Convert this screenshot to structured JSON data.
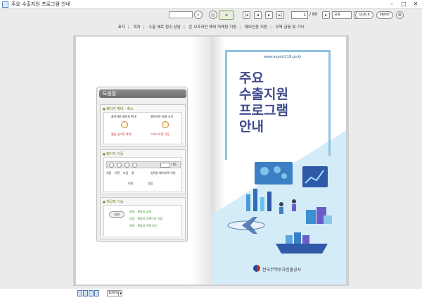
{
  "window": {
    "title": "주요 수출지원 프로그램 안내"
  },
  "toolbar": {
    "search_placeholder": "",
    "page_current": "1",
    "page_total": "/ 80",
    "zoom_option": "공동",
    "quick_label": "QUICK",
    "print_label": "PRINT"
  },
  "toc": {
    "items": [
      "표지",
      "목차",
      "수출 애로 접수·상담",
      "온·오프라인 해외 마케팅 지원",
      "해외인증 지원",
      "무역 금융 및 기타"
    ]
  },
  "help": {
    "title": "도움말",
    "sections": {
      "zoom": {
        "heading": "페이지 확대 · 축소",
        "left_label": "클릭하면 페이지 확대",
        "left_caption": "휠을 굴리면 확대",
        "right_label": "클릭하면 원래 크기",
        "right_caption": "드래그하면 이동"
      },
      "move": {
        "heading": "페이지 이동",
        "total": "/ 56",
        "labels": [
          "처음",
          "이전",
          "다음",
          "끝",
          "입력한 페이지로 이동"
        ],
        "prev": "이전",
        "next": "다음"
      },
      "bookmark": {
        "heading": "책갈피 기능",
        "pill": "검색",
        "lines": [
          "검색 - 책갈피 검색",
          "이동 - 책갈피 목록으로 이동",
          "목록 - 책갈피 목록 열기"
        ]
      }
    }
  },
  "cover": {
    "url": "www.export119.go.kr",
    "title_lines": [
      "주요",
      "수출지원",
      "프로그램",
      "안내"
    ],
    "org": "한국무역투자진흥공사"
  },
  "bottom": {
    "zoom": "100%"
  },
  "colors": {
    "accent_green": "#6a8a2a",
    "cover_blue": "#3e4a8c",
    "frame_blue": "#8ec3de"
  }
}
